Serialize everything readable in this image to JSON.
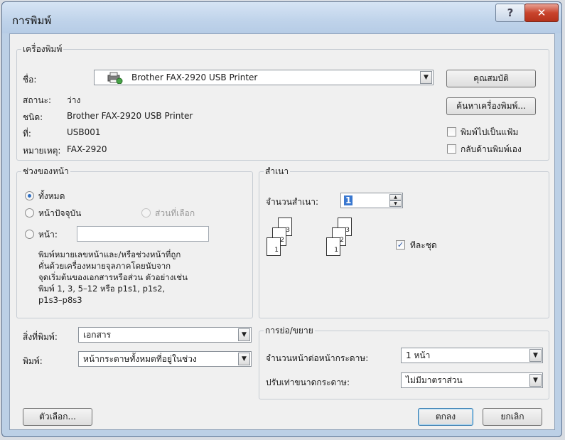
{
  "dialog": {
    "title": "การพิมพ์",
    "help_glyph": "?",
    "close_glyph": "✕"
  },
  "printer": {
    "group_label": "เครื่องพิมพ์",
    "name_label": "ชื่อ:",
    "name_value": "Brother FAX-2920 USB Printer",
    "status_label": "สถานะ:",
    "status_value": "ว่าง",
    "type_label": "ชนิด:",
    "type_value": "Brother FAX-2920 USB Printer",
    "where_label": "ที่:",
    "where_value": "USB001",
    "comment_label": "หมายเหตุ:",
    "comment_value": "FAX-2920",
    "properties_button": "คุณสมบัติ",
    "find_printer_button": "ค้นหาเครื่องพิมพ์...",
    "print_to_file_label": "พิมพ์ไปเป็นแฟ้ม",
    "print_to_file_checked": false,
    "manual_duplex_label": "กลับด้านพิมพ์เอง",
    "manual_duplex_checked": false
  },
  "page_range": {
    "group_label": "ช่วงของหน้า",
    "all_label": "ทั้งหมด",
    "current_label": "หน้าปัจจุบัน",
    "selection_label": "ส่วนที่เลือก",
    "pages_label": "หน้า:",
    "pages_value": "",
    "selected": "all",
    "help_lines": [
      "พิมพ์หมายเลขหน้าและ/หรือช่วงหน้าที่ถูก",
      "คั่นด้วยเครื่องหมายจุลภาคโดยนับจาก",
      "จุดเริ่มต้นของเอกสารหรือส่วน ตัวอย่างเช่น",
      "พิมพ์ 1, 3, 5–12 หรือ p1s1, p1s2,",
      "p1s3–p8s3"
    ]
  },
  "copies": {
    "group_label": "สำเนา",
    "count_label": "จำนวนสำเนา:",
    "count_value": "1",
    "collate_label": "ทีละชุด",
    "collate_checked": true,
    "page_numbers": [
      "1",
      "2",
      "3"
    ]
  },
  "print_what": {
    "label": "สิ่งที่พิมพ์:",
    "value": "เอกสาร"
  },
  "print_mode": {
    "label": "พิมพ์:",
    "value": "หน้ากระดาษทั้งหมดที่อยู่ในช่วง"
  },
  "zoom": {
    "group_label": "การย่อ/ขยาย",
    "pages_per_sheet_label": "จำนวนหน้าต่อหน้ากระดาษ:",
    "pages_per_sheet_value": "1 หน้า",
    "scale_label": "ปรับเท่าขนาดกระดาษ:",
    "scale_value": "ไม่มีมาตราส่วน"
  },
  "footer": {
    "options_button": "ตัวเลือก...",
    "ok_button": "ตกลง",
    "cancel_button": "ยกเลิก"
  },
  "icons": {
    "dropdown": "▼",
    "spin_up": "▲",
    "spin_down": "▼",
    "check": "✓"
  }
}
